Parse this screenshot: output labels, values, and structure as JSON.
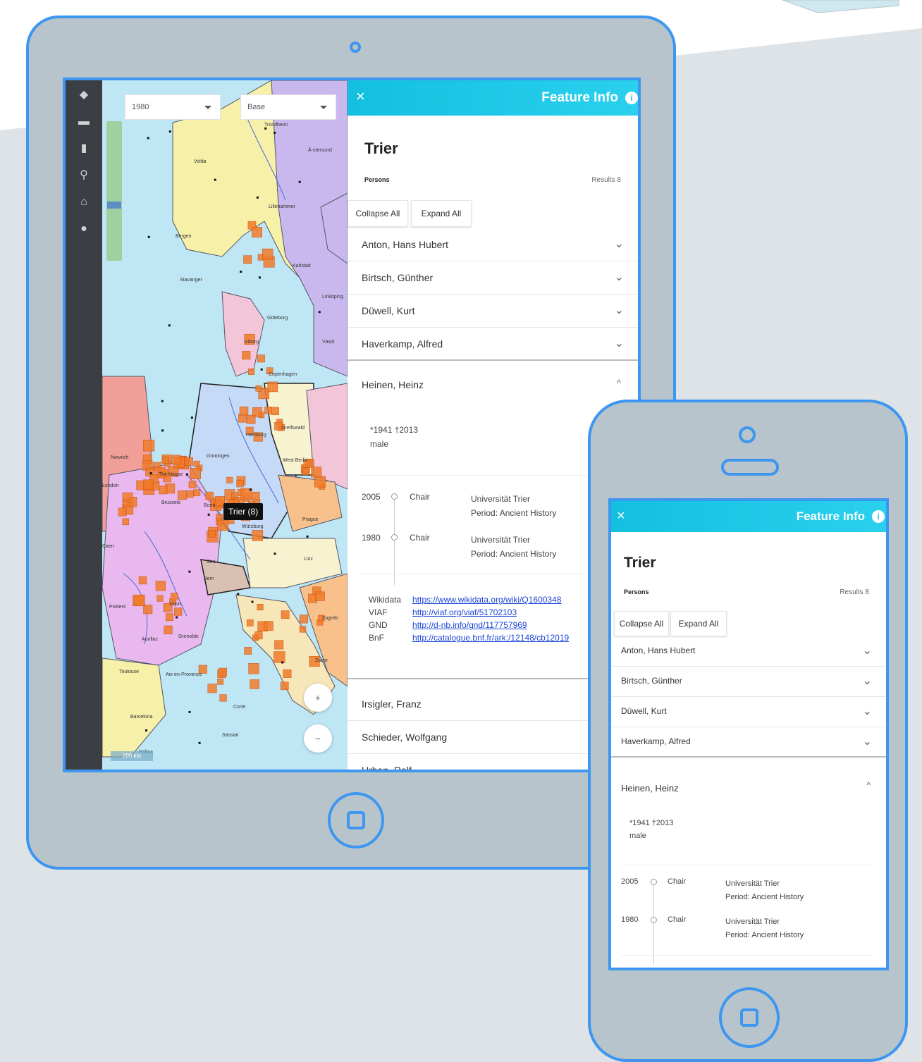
{
  "tablet": {
    "map": {
      "year_select": "1980",
      "layer_select": "Base",
      "tooltip": "Trier (8)",
      "zoom_in": "+",
      "zoom_out": "−",
      "scale": "200 km",
      "cities": [
        "Trondheim",
        "Å-stersund",
        "Volda",
        "Lillehammer",
        "Bergen",
        "Stavanger",
        "Karlstad",
        "Linköping",
        "Göteborg",
        "Växjö",
        "Viborg",
        "Copenhagen",
        "Greifswald",
        "Hamburg",
        "Groningen",
        "West Berlin",
        "Norwich",
        "The Hague",
        "London",
        "Brussels",
        "Bonn",
        "Würzburg",
        "Prague",
        "Caen",
        "Stra",
        "Linz",
        "Dijon",
        "Bern",
        "Poitiers",
        "Aurillac",
        "Grenoble",
        "Zagreb",
        "Toulouse",
        "Aix-en-Provence",
        "Zadar",
        "Corte",
        "Barcelona",
        "Sassari",
        "Palma"
      ]
    },
    "panel": {
      "header_title": "Feature Info",
      "place": "Trier",
      "persons_label": "Persons",
      "results": "Results 8",
      "collapse_all": "Collapse All",
      "expand_all": "Expand All",
      "persons_before": [
        "Anton, Hans Hubert",
        "Birtsch, Günther",
        "Düwell, Kurt",
        "Haverkamp, Alfred"
      ],
      "open_person": {
        "name": "Heinen, Heinz",
        "life": "*1941  †2013",
        "gender": "male",
        "timeline": [
          {
            "year": "2005",
            "role": "Chair",
            "place": "Universität Trier",
            "period": "Period: Ancient History"
          },
          {
            "year": "1980",
            "role": "Chair",
            "place": "Universität Trier",
            "period": "Period: Ancient History"
          }
        ],
        "links": [
          {
            "label": "Wikidata",
            "url": "https://www.wikidata.org/wiki/Q1600348"
          },
          {
            "label": "VIAF",
            "url": "http://viaf.org/viaf/51702103"
          },
          {
            "label": "GND",
            "url": "http://d-nb.info/gnd/117757969"
          },
          {
            "label": "BnF",
            "url": "http://catalogue.bnf.fr/ark:/12148/cb12019"
          }
        ]
      },
      "persons_after": [
        "Irsigler, Franz",
        "Schieder, Wolfgang",
        "Urban, Ralf"
      ]
    }
  },
  "phone": {
    "panel": {
      "header_title": "Feature Info",
      "place": "Trier",
      "persons_label": "Persons",
      "results": "Results 8",
      "collapse_all": "Collapse All",
      "expand_all": "Expand All",
      "persons_before": [
        "Anton, Hans Hubert",
        "Birtsch, Günther",
        "Düwell, Kurt",
        "Haverkamp, Alfred"
      ],
      "open_person": {
        "name": "Heinen, Heinz",
        "life": "*1941  †2013",
        "gender": "male",
        "timeline": [
          {
            "year": "2005",
            "role": "Chair",
            "place": "Universität Trier",
            "period": "Period: Ancient History"
          },
          {
            "year": "1980",
            "role": "Chair",
            "place": "Universität Trier",
            "period": "Period: Ancient History"
          }
        ]
      }
    }
  },
  "icons": {
    "close": "×",
    "chevron_down": "⌄",
    "chevron_up": "^",
    "info": "i"
  },
  "colors": {
    "device_frame": "#b8c4cb",
    "device_border": "#3d96f0",
    "header": "#1fc8e8",
    "sidebar": "#3b3f44",
    "marker": "#f07a2a"
  }
}
